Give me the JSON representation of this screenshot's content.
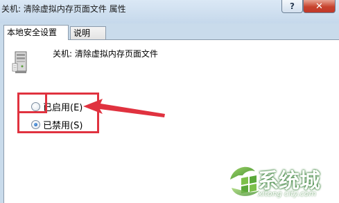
{
  "window": {
    "title": "关机: 清除虚拟内存页面文件 属性",
    "help_label": "?",
    "close_label": "✕"
  },
  "tabs": [
    {
      "label": "本地安全设置",
      "active": true
    },
    {
      "label": "说明",
      "active": false
    }
  ],
  "policy": {
    "name": "关机: 清除虚拟内存页面文件",
    "icon": "server-policy-icon"
  },
  "options": [
    {
      "label": "已启用(E)",
      "checked": false
    },
    {
      "label": "已禁用(S)",
      "checked": true
    }
  ],
  "annotation_color": "#e0323f",
  "watermark": {
    "title": "系统城",
    "url": "xitong city.com"
  }
}
